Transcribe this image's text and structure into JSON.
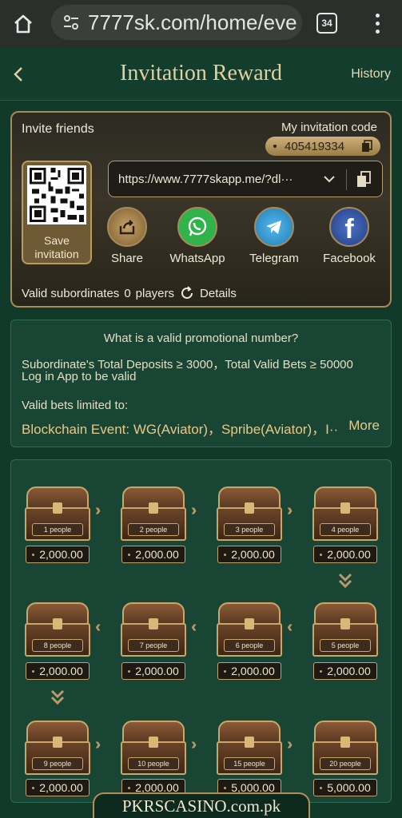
{
  "browser": {
    "url": "7777sk.com/home/eve",
    "tab_count": "34"
  },
  "header": {
    "title": "Invitation Reward",
    "history_label": "History"
  },
  "invite": {
    "invite_friends_label": "Invite friends",
    "code_label": "My invitation code",
    "code_value": "405419334",
    "save_label_line1": "Save",
    "save_label_line2": "invitation",
    "link_text": "https://www.7777skapp.me/?dl···",
    "share_options": [
      {
        "label": "Share",
        "icon": "share-icon",
        "color": "#b08a4e"
      },
      {
        "label": "WhatsApp",
        "icon": "whatsapp-icon",
        "color": "#2fb34a"
      },
      {
        "label": "Telegram",
        "icon": "telegram-icon",
        "color": "#2c9ad6"
      },
      {
        "label": "Facebook",
        "icon": "facebook-icon",
        "color": "#2d4f9e"
      }
    ],
    "subordinates_label": "Valid subordinates",
    "subordinates_count": "0",
    "subordinates_unit": "players",
    "details_label": "Details"
  },
  "info": {
    "question": "What is a valid promotional number?",
    "line1": "Subordinate's Total Deposits ≥ 3000，Total Valid Bets ≥ 50000",
    "line2": "Log in App to be valid",
    "line3": "Valid bets limited to:",
    "line4": "Blockchain Event: WG(Aviator)，Spribe(Aviator)，I···",
    "more_label": "More"
  },
  "rewards": [
    {
      "people": "1 people",
      "amount": "2,000.00"
    },
    {
      "people": "2 people",
      "amount": "2,000.00"
    },
    {
      "people": "3 people",
      "amount": "2,000.00"
    },
    {
      "people": "4 people",
      "amount": "2,000.00"
    },
    {
      "people": "5 people",
      "amount": "2,000.00"
    },
    {
      "people": "6 people",
      "amount": "2,000.00"
    },
    {
      "people": "7 people",
      "amount": "2,000.00"
    },
    {
      "people": "8 people",
      "amount": "2,000.00"
    },
    {
      "people": "9 people",
      "amount": "2,000.00"
    },
    {
      "people": "10 people",
      "amount": "2,000.00"
    },
    {
      "people": "15 people",
      "amount": "5,000.00"
    },
    {
      "people": "20 people",
      "amount": "5,000.00"
    }
  ],
  "watermark": "PKRSCASINO.com.pk",
  "colors": {
    "background": "#123a2b",
    "gold": "#c9a66a",
    "accent_text": "#e8c88a"
  }
}
